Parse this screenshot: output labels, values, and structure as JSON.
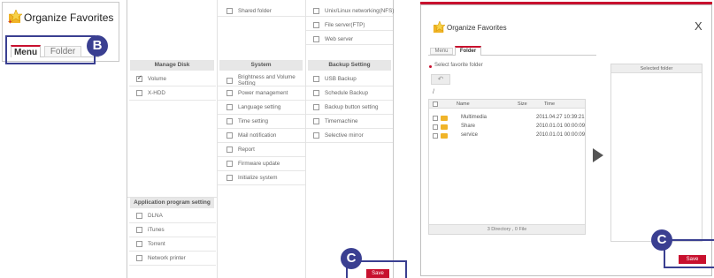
{
  "panel1": {
    "title": "Organize Favorites",
    "tabs": {
      "menu": "Menu",
      "folder": "Folder"
    },
    "badge": "B"
  },
  "panel2": {
    "top_col2": {
      "item": "Shared folder"
    },
    "top_col3": {
      "items": [
        "Unix/Linux networking(NFS)",
        "File server(FTP)",
        "Web server"
      ]
    },
    "manage_disk": {
      "title": "Manage Disk",
      "items": [
        "Volume",
        "X-HDD"
      ],
      "checked": [
        true,
        false
      ]
    },
    "system": {
      "title": "System",
      "items": [
        "Brightness and Volume",
        "Power management",
        "Language setting",
        "Time setting",
        "Mail notification",
        "Report",
        "Firmware update",
        "Initialize system"
      ],
      "item1_line2": "Setting"
    },
    "backup": {
      "title": "Backup Setting",
      "items": [
        "USB Backup",
        "Schedule Backup",
        "Backup button setting",
        "Timemachine",
        "Selective mirror"
      ]
    },
    "app": {
      "title": "Application program setting",
      "items": [
        "DLNA",
        "iTunes",
        "Torrent",
        "Network printer"
      ]
    },
    "save_label": "Save",
    "badge": "C"
  },
  "panel3": {
    "title": "Organize Favorites",
    "close": "X",
    "tabs": {
      "menu": "Menu",
      "folder": "Folder"
    },
    "select_label": "Select favorite folder",
    "path": "/",
    "columns": {
      "name": "Name",
      "size": "Size",
      "time": "Time"
    },
    "rows": [
      {
        "name": "Multimedia",
        "time": "2011.04.27 10:39:21"
      },
      {
        "name": "Share",
        "time": "2010.01.01 00:00:09"
      },
      {
        "name": "service",
        "time": "2010.01.01 00:00:09"
      }
    ],
    "footer": "3 Directory , 0 File",
    "selected_header": "Selected folder",
    "save_label": "Save",
    "badge": "C"
  },
  "colors": {
    "accent": "#c8102e",
    "annotation": "#3a3f91",
    "folder": "#f0b429"
  }
}
